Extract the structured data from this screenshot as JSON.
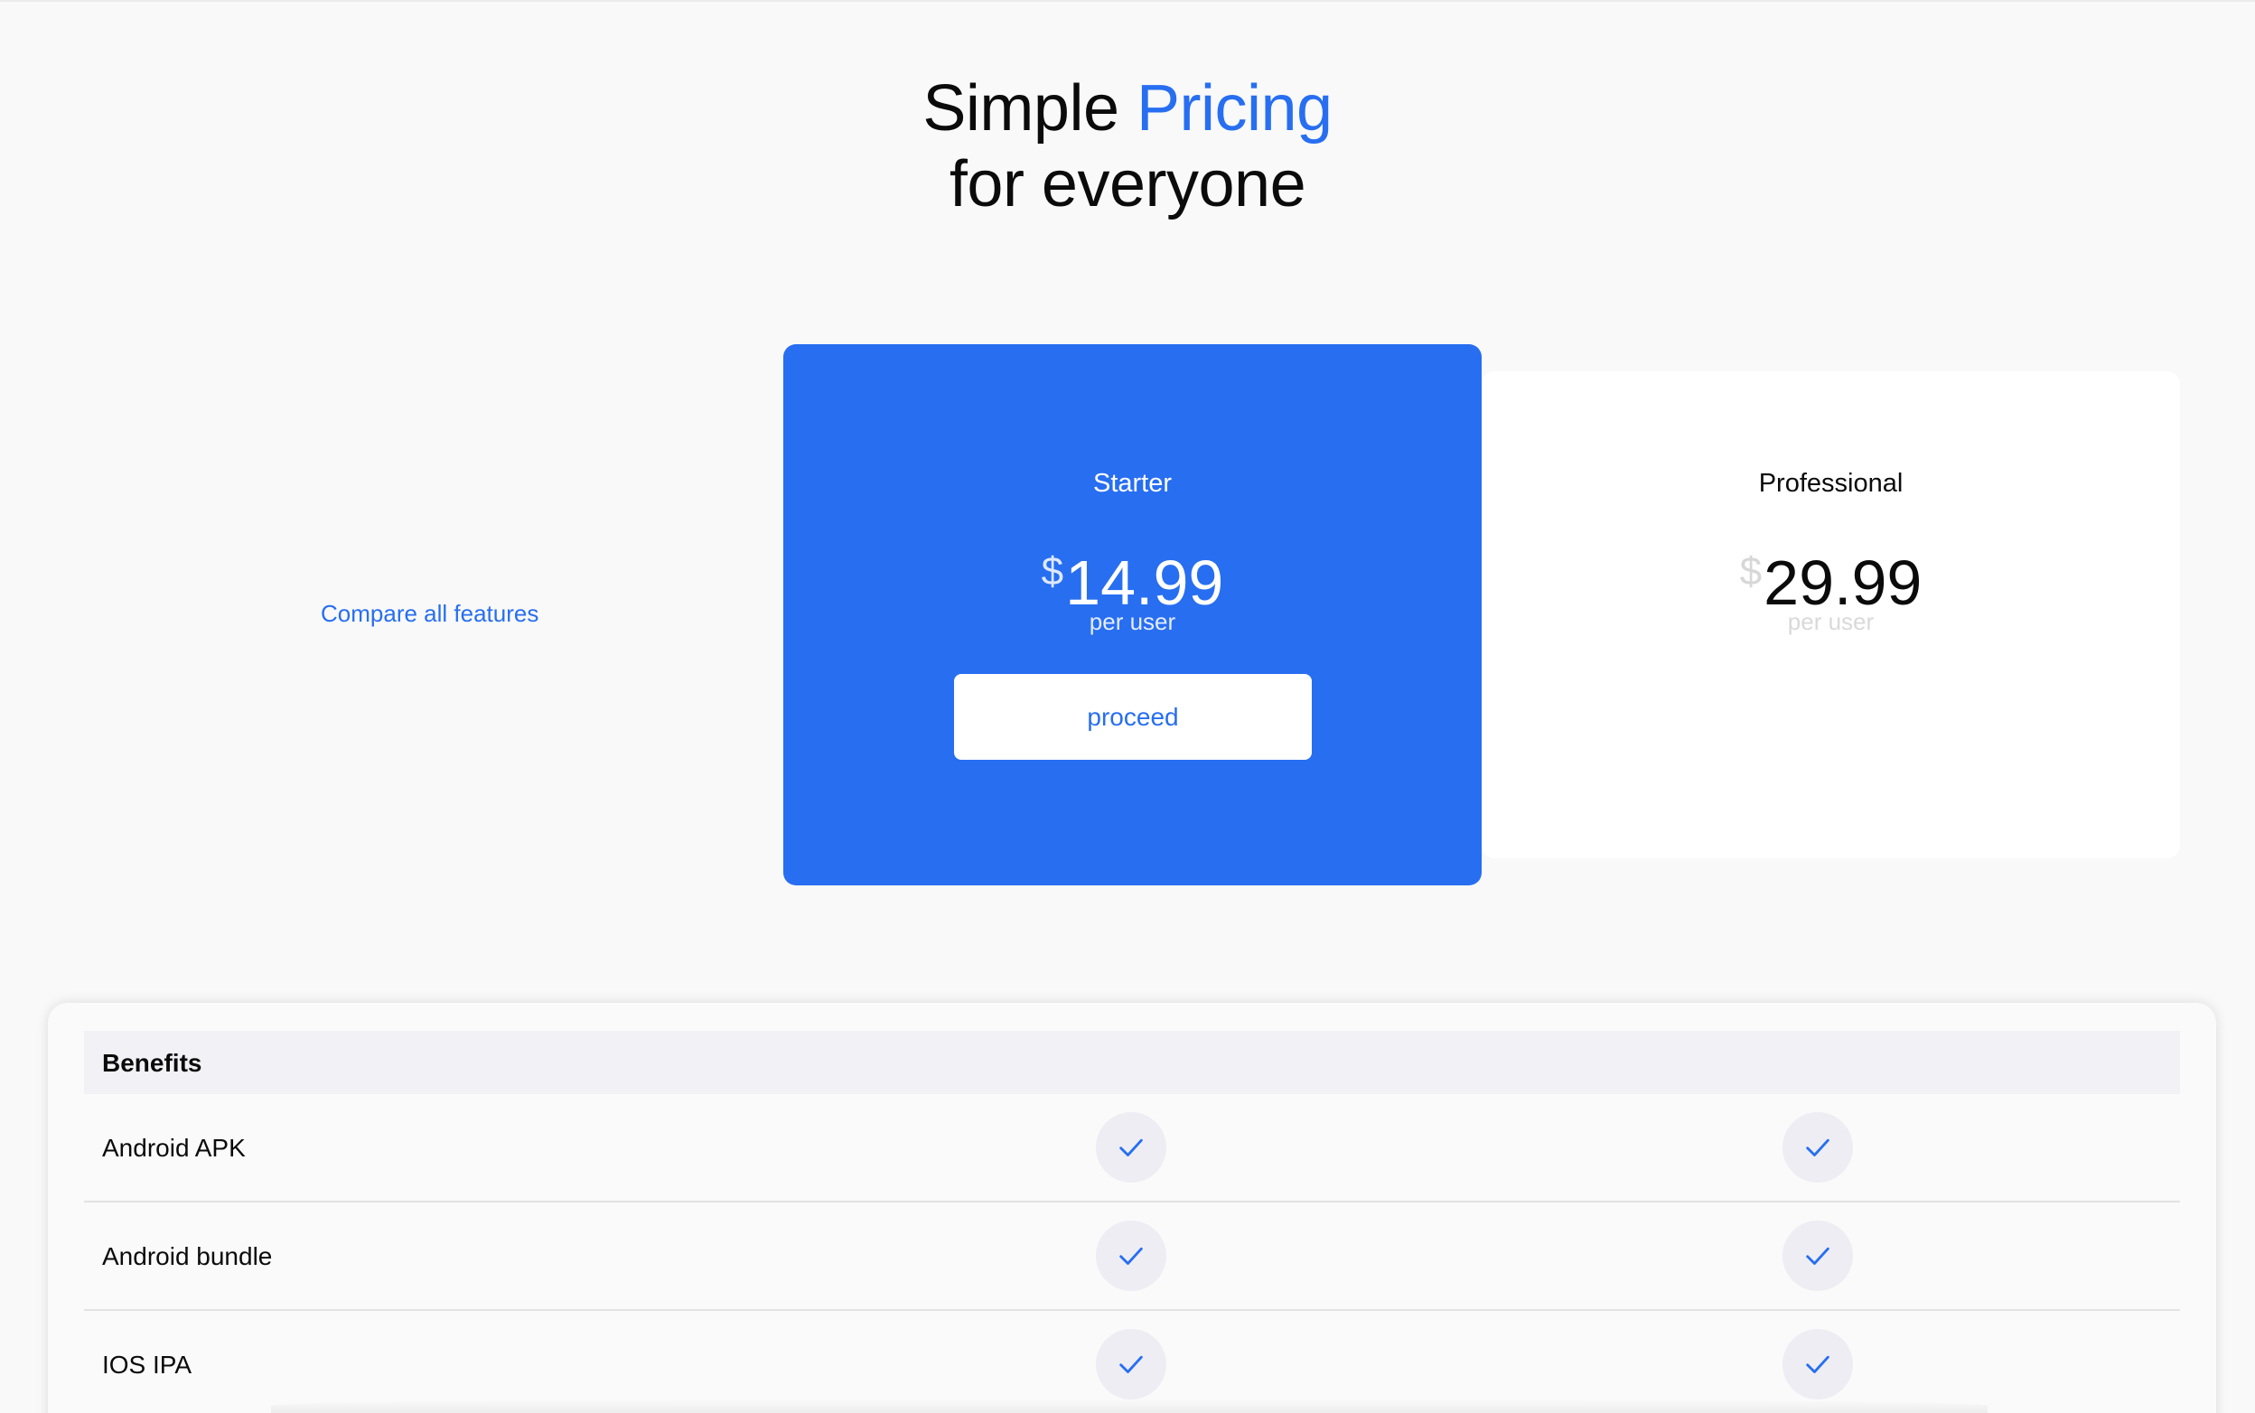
{
  "headline": {
    "line1_plain": "Simple ",
    "line1_accent": "Pricing",
    "line2": "for everyone"
  },
  "compare_link": "Compare all features",
  "plans": [
    {
      "name": "Starter",
      "currency": "$",
      "price": "14.99",
      "period": "per user",
      "button_label": "proceed",
      "highlighted": true
    },
    {
      "name": "Professional",
      "currency": "$",
      "price": "29.99",
      "period": "per user",
      "highlighted": false
    }
  ],
  "benefits_table": {
    "header": "Benefits",
    "rows": [
      {
        "label": "Android APK",
        "starter": true,
        "professional": true
      },
      {
        "label": "Android bundle",
        "starter": true,
        "professional": true
      },
      {
        "label": "IOS IPA",
        "starter": true,
        "professional": true
      }
    ]
  },
  "colors": {
    "accent": "#276ef1",
    "background": "#f9f9f9",
    "card_white": "#ffffff",
    "check_circle_bg": "#ededf3"
  },
  "icons": {
    "check": "check-icon"
  }
}
